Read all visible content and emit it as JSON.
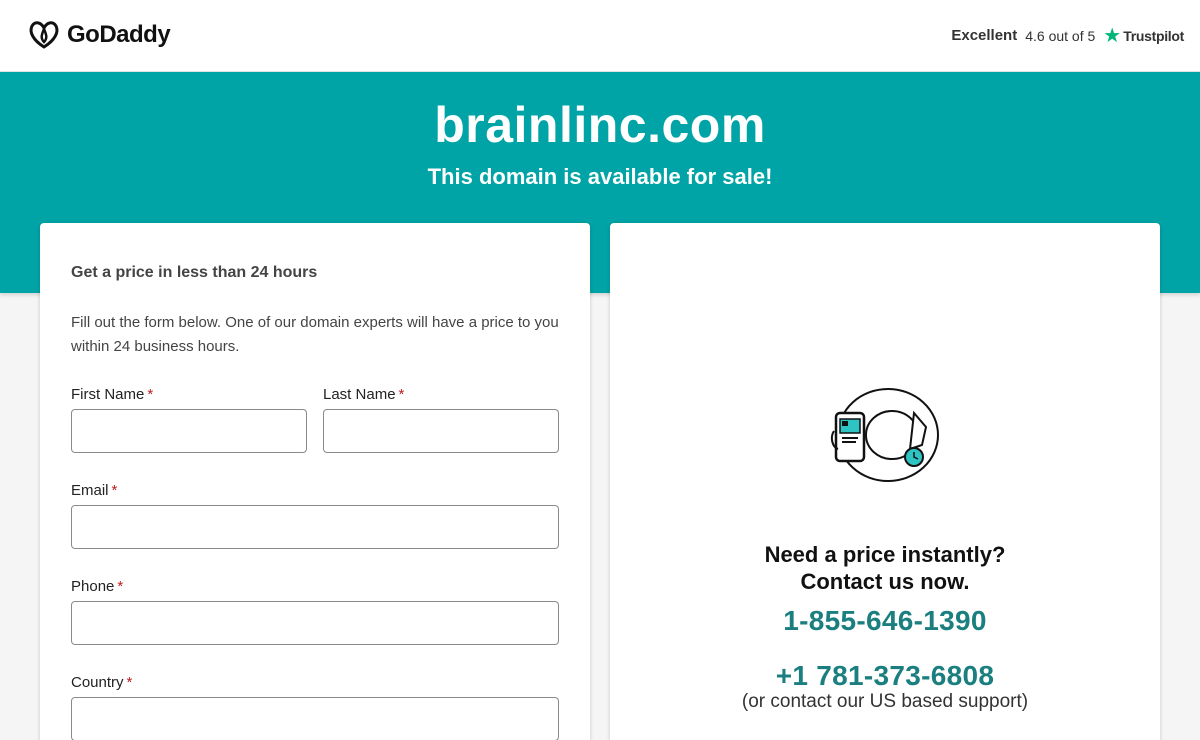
{
  "header": {
    "brand": "GoDaddy",
    "rating_word": "Excellent",
    "rating_score": "4.6 out of 5",
    "rating_source": "Trustpilot"
  },
  "banner": {
    "domain": "brainlinc.com",
    "subtitle": "This domain is available for sale!"
  },
  "form": {
    "heading": "Get a price in less than 24 hours",
    "description": "Fill out the form below. One of our domain experts will have a price to you within 24 business hours.",
    "required_mark": "*",
    "fields": {
      "first_name": {
        "label": "First Name",
        "value": ""
      },
      "last_name": {
        "label": "Last Name",
        "value": ""
      },
      "email": {
        "label": "Email",
        "value": ""
      },
      "phone": {
        "label": "Phone",
        "value": ""
      },
      "country": {
        "label": "Country",
        "value": ""
      }
    }
  },
  "contact": {
    "heading_line1": "Need a price instantly?",
    "heading_line2": "Contact us now.",
    "phone_primary": "1-855-646-1390",
    "phone_secondary": "+1 781-373-6808",
    "support_note": "(or contact our US based support)"
  },
  "colors": {
    "banner": "#00a4a6",
    "phone_link": "#1b7f7f",
    "trustpilot_star": "#00b67a",
    "required": "#c01a1a"
  }
}
